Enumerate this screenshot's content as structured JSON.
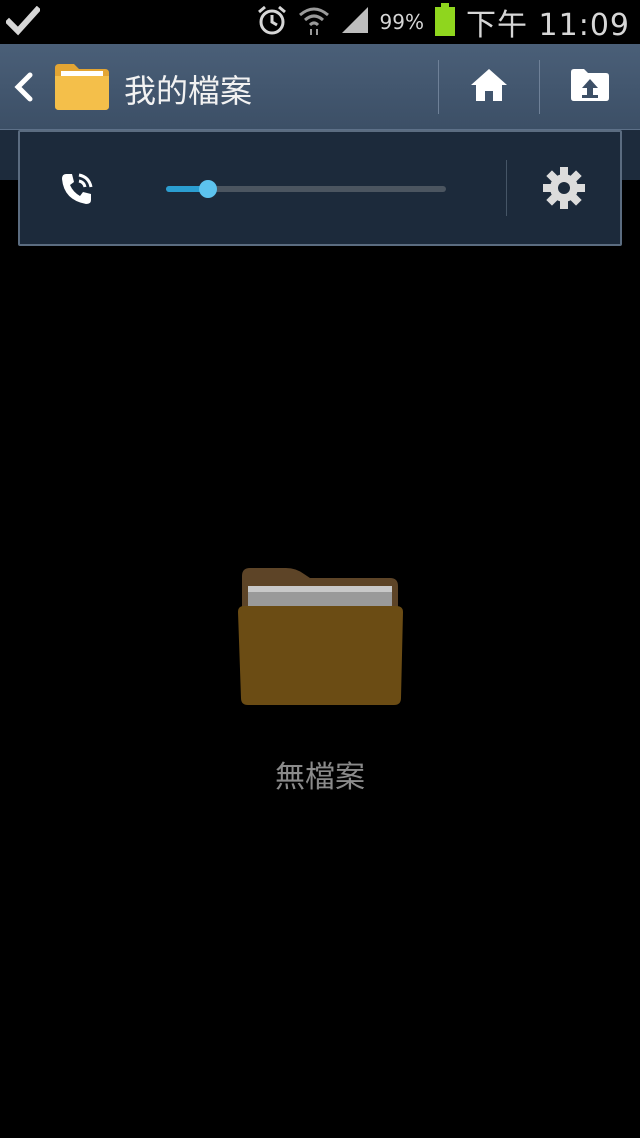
{
  "status_bar": {
    "battery_percent": "99%",
    "time": "下午 11:09",
    "icons": [
      "checkmark-icon",
      "alarm-icon",
      "wifi-icon",
      "signal-icon",
      "battery-icon"
    ]
  },
  "action_bar": {
    "title": "我的檔案",
    "icons": [
      "back-arrow-icon",
      "folder-icon",
      "home-icon",
      "folder-up-icon"
    ]
  },
  "volume_panel": {
    "stream_icon": "phone-call-icon",
    "level": 0.15,
    "settings_icon": "gear-icon",
    "accent_color": "#2b9ed1"
  },
  "empty_state": {
    "icon": "empty-folder-icon",
    "message": "無檔案"
  }
}
